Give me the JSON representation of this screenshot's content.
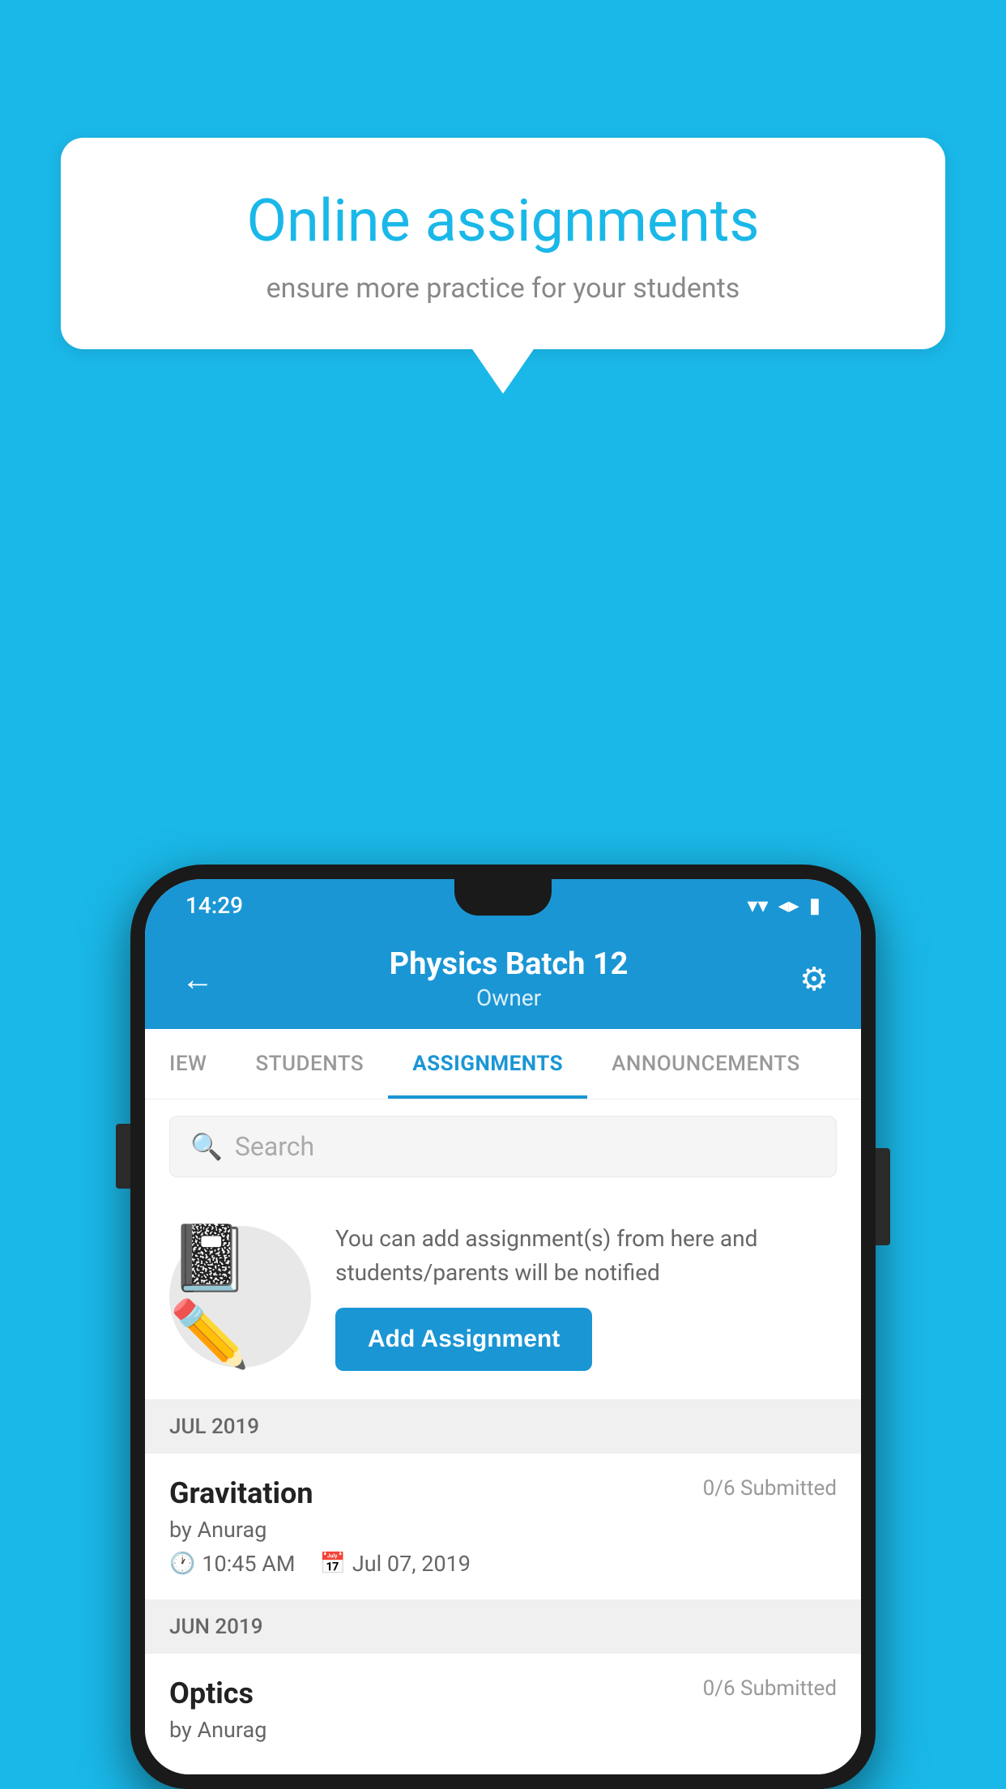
{
  "background": {
    "color": "#1ab8e8"
  },
  "speech_bubble": {
    "title": "Online assignments",
    "subtitle": "ensure more practice for your students"
  },
  "status_bar": {
    "time": "14:29",
    "wifi": "▼",
    "signal": "▲",
    "battery": "▐"
  },
  "header": {
    "title": "Physics Batch 12",
    "subtitle": "Owner",
    "back_icon": "←",
    "settings_icon": "⚙"
  },
  "tabs": [
    {
      "label": "IEW",
      "active": false
    },
    {
      "label": "STUDENTS",
      "active": false
    },
    {
      "label": "ASSIGNMENTS",
      "active": true
    },
    {
      "label": "ANNOUNCEMENTS",
      "active": false
    }
  ],
  "search": {
    "placeholder": "Search"
  },
  "promo": {
    "text": "You can add assignment(s) from here and students/parents will be notified",
    "button_label": "Add Assignment"
  },
  "sections": [
    {
      "month": "JUL 2019",
      "assignments": [
        {
          "title": "Gravitation",
          "submitted": "0/6 Submitted",
          "author": "by Anurag",
          "time": "10:45 AM",
          "date": "Jul 07, 2019"
        }
      ]
    },
    {
      "month": "JUN 2019",
      "assignments": [
        {
          "title": "Optics",
          "submitted": "0/6 Submitted",
          "author": "by Anurag",
          "time": "",
          "date": ""
        }
      ]
    }
  ]
}
